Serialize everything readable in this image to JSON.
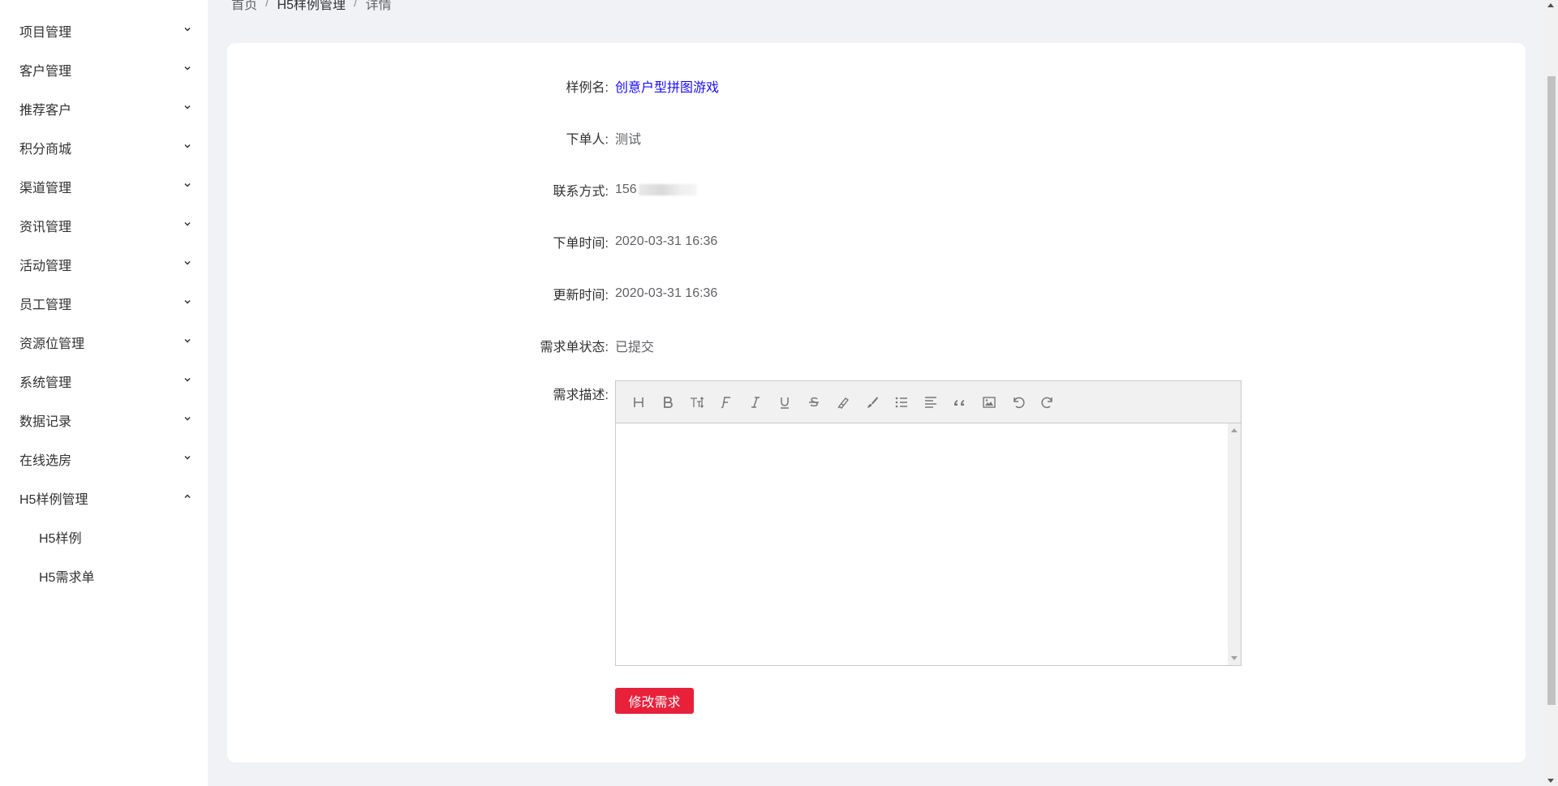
{
  "sidebar": {
    "items": [
      {
        "label": "项目管理",
        "icon": "chevron-down-icon"
      },
      {
        "label": "客户管理",
        "icon": "chevron-down-icon"
      },
      {
        "label": "推荐客户",
        "icon": "chevron-down-icon"
      },
      {
        "label": "积分商城",
        "icon": "chevron-down-icon"
      },
      {
        "label": "渠道管理",
        "icon": "chevron-down-icon"
      },
      {
        "label": "资讯管理",
        "icon": "chevron-down-icon"
      },
      {
        "label": "活动管理",
        "icon": "chevron-down-icon"
      },
      {
        "label": "员工管理",
        "icon": "chevron-down-icon"
      },
      {
        "label": "资源位管理",
        "icon": "chevron-down-icon"
      },
      {
        "label": "系统管理",
        "icon": "chevron-down-icon"
      },
      {
        "label": "数据记录",
        "icon": "chevron-down-icon"
      },
      {
        "label": "在线选房",
        "icon": "chevron-down-icon"
      },
      {
        "label": "H5样例管理",
        "icon": "chevron-up-icon",
        "expanded": true
      }
    ],
    "subitems": [
      {
        "label": "H5样例"
      },
      {
        "label": "H5需求单"
      }
    ]
  },
  "breadcrumb": {
    "items": [
      "首页",
      "H5样例管理",
      "详情"
    ],
    "separator": "/"
  },
  "detail": {
    "name_label": "样例名:",
    "name_value": "创意户型拼图游戏",
    "orderer_label": "下单人:",
    "orderer_value": "测试",
    "contact_label": "联系方式:",
    "contact_value": "156",
    "order_time_label": "下单时间:",
    "order_time_value": "2020-03-31 16:36",
    "update_time_label": "更新时间:",
    "update_time_value": "2020-03-31 16:36",
    "status_label": "需求单状态:",
    "status_value": "已提交",
    "description_label": "需求描述:"
  },
  "editor": {
    "toolbar": [
      "heading-icon",
      "bold-icon",
      "font-size-icon",
      "font-family-icon",
      "italic-icon",
      "underline-icon",
      "strikethrough-icon",
      "fore-color-icon",
      "back-color-icon",
      "list-icon",
      "justify-icon",
      "quote-icon",
      "image-icon",
      "undo-icon",
      "redo-icon"
    ],
    "content": ""
  },
  "actions": {
    "modify_label": "修改需求"
  },
  "colors": {
    "primary_button": "#e8203a",
    "link": "#1a0dff"
  }
}
